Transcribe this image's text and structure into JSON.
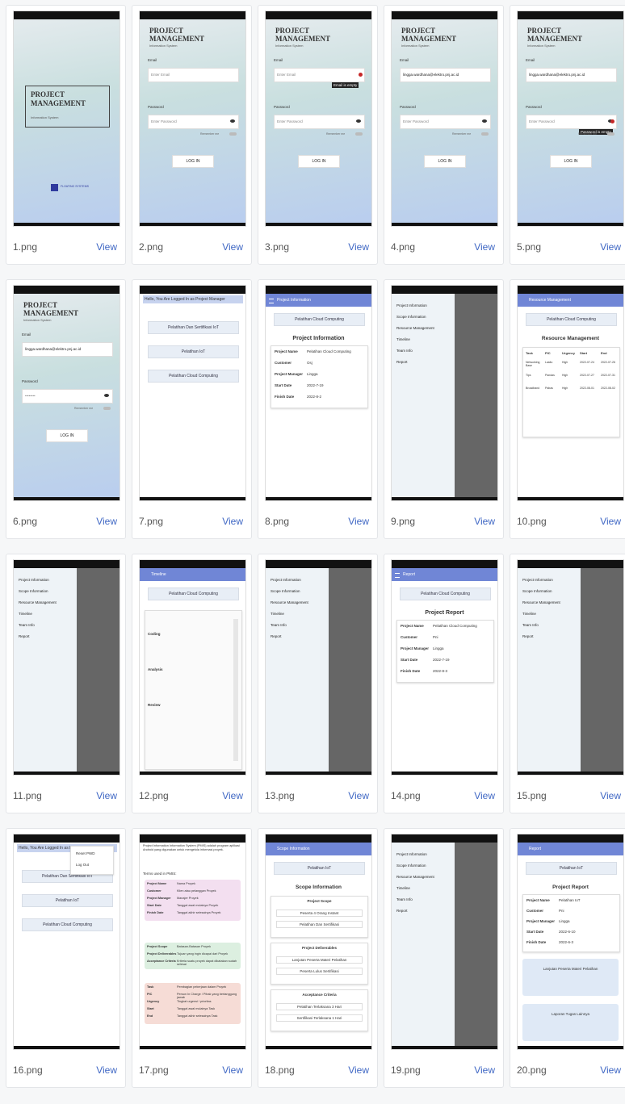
{
  "gallery": [
    {
      "file": "1.png",
      "view": "View"
    },
    {
      "file": "2.png",
      "view": "View"
    },
    {
      "file": "3.png",
      "view": "View"
    },
    {
      "file": "4.png",
      "view": "View"
    },
    {
      "file": "5.png",
      "view": "View"
    },
    {
      "file": "6.png",
      "view": "View"
    },
    {
      "file": "7.png",
      "view": "View"
    },
    {
      "file": "8.png",
      "view": "View"
    },
    {
      "file": "9.png",
      "view": "View"
    },
    {
      "file": "10.png",
      "view": "View"
    },
    {
      "file": "11.png",
      "view": "View"
    },
    {
      "file": "12.png",
      "view": "View"
    },
    {
      "file": "13.png",
      "view": "View"
    },
    {
      "file": "14.png",
      "view": "View"
    },
    {
      "file": "15.png",
      "view": "View"
    },
    {
      "file": "16.png",
      "view": "View"
    },
    {
      "file": "17.png",
      "view": "View"
    },
    {
      "file": "18.png",
      "view": "View"
    },
    {
      "file": "19.png",
      "view": "View"
    },
    {
      "file": "20.png",
      "view": "View"
    }
  ],
  "app": {
    "title_line1": "PROJECT",
    "title_line2": "MANAGEMENT",
    "subtitle": "Information System",
    "vendor": "FLOATING SYSTEMS",
    "email_label": "Email",
    "email_placeholder": "Enter Email",
    "email_value": "lingga.wardhana@elektro.pnj.ac.id",
    "password_label": "Password",
    "password_placeholder": "Enter Password",
    "password_value": "••••••••",
    "remember": "Remember me",
    "login": "LOG IN",
    "email_error": "Email is empty",
    "password_error": "Password is empty",
    "greeting": "Hello, You Are Logged In as Project Manager",
    "projects": [
      "Pelatihan Dan Sertifikasi IoT",
      "Pelatihan IoT",
      "Pelatihan Cloud Computing"
    ],
    "menu": [
      "Project Information",
      "Scope Information",
      "Resource Management",
      "Timeline",
      "Team Info",
      "Report"
    ],
    "popup": [
      "Reset PWD",
      "Log Out"
    ]
  },
  "project_info": {
    "bar": "Project Information",
    "selected": "Pelatihan Cloud Computing",
    "heading": "Project Information",
    "rows": [
      [
        "Project Name",
        "Pelatihan Cloud Computing"
      ],
      [
        "Customer",
        "Osj"
      ],
      [
        "Project Manager",
        "Lingga"
      ],
      [
        "Start Date",
        "2022-7-19"
      ],
      [
        "Finish Date",
        "2022-8-2"
      ]
    ]
  },
  "resource": {
    "bar": "Resource Management",
    "heading": "Resource Management",
    "cols": [
      "Task",
      "PIC",
      "Urgency",
      "Start",
      "End"
    ],
    "rows": [
      [
        "Networking Base",
        "Lasito",
        "High",
        "2022-07-24",
        "2022-07-26"
      ],
      [
        "Tips",
        "Pandas",
        "High",
        "2022-07-27",
        "2022-07-31"
      ],
      [
        "Broadband",
        "Pabas",
        "High",
        "2022-08-01",
        "2022-08-02"
      ]
    ]
  },
  "timeline": {
    "bar": "Timeline",
    "tasks": [
      "Coding",
      "Analysis",
      "Review"
    ]
  },
  "report": {
    "bar": "Report",
    "heading": "Project Report",
    "rows": [
      [
        "Project Name",
        "Pelatihan Cloud Computing"
      ],
      [
        "Customer",
        "Pni"
      ],
      [
        "Project Manager",
        "Lingga"
      ],
      [
        "Start Date",
        "2022-7-19"
      ],
      [
        "Finish Date",
        "2022-8-3"
      ]
    ],
    "rows2": [
      [
        "Project Name",
        "Pelatihan IoT"
      ],
      [
        "Customer",
        "Pni"
      ],
      [
        "Project Manager",
        "Lingga"
      ],
      [
        "Start Date",
        "2022-6-10"
      ],
      [
        "Finish Date",
        "2022-6-3"
      ]
    ]
  },
  "scope": {
    "bar": "Scope Information",
    "selected": "Pelatihan IoT",
    "heading": "Scope Information",
    "groups": [
      {
        "title": "Project Scope",
        "items": [
          "Peserta 4 Orang Instant",
          "Pelatihan Dan Sertifikasi"
        ]
      },
      {
        "title": "Project Deliverables",
        "items": [
          "Lanjutan Peserta Materi Pelatihan",
          "Peserta Lulus Sertifikasi"
        ]
      },
      {
        "title": "Acceptance Criteria",
        "items": [
          "Pelatihan Terlaksana 3 Hari",
          "Sertifikasi Terlaksana 1 Hari"
        ]
      }
    ]
  },
  "help": {
    "intro": "Project Information Information System (PMIS) adalah program aplikasi Android yang digunakan untuk mengelola informasi proyek.",
    "terms": "Terms used in PMIS:",
    "pink": [
      [
        "Project Name",
        "Nama Proyek"
      ],
      [
        "Customer",
        "Klien atau pelanggan Proyek"
      ],
      [
        "Project Manager",
        "Manajer Proyek"
      ],
      [
        "Start Date",
        "Tanggal awal mulainya Proyek"
      ],
      [
        "Finish Date",
        "Tanggal akhir selesainya Proyek"
      ]
    ],
    "green": [
      [
        "Project Scope",
        "Batasan-Batasan Proyek"
      ],
      [
        "Project Deliverables",
        "Tujuan yang ingin dicapai dari Proyek"
      ],
      [
        "Acceptance Criteria",
        "Kriteria suatu proyek dapat dikatakan sudah selesai"
      ]
    ],
    "orange": [
      [
        "Task",
        "Pembagian pekerjaan dalam Proyek"
      ],
      [
        "PIC",
        "Person In Charge / Pihak yang bertanggung jawab"
      ],
      [
        "Urgency",
        "Tingkat urgensi / prioritas"
      ],
      [
        "Start",
        "Tanggal awal mulainya Task"
      ],
      [
        "End",
        "Tanggal akhir selesainya Task"
      ]
    ]
  },
  "report_boxes": [
    "Lanjutan Peserta Materi Pelatihan",
    "Laporan Tugas Lainnya"
  ]
}
